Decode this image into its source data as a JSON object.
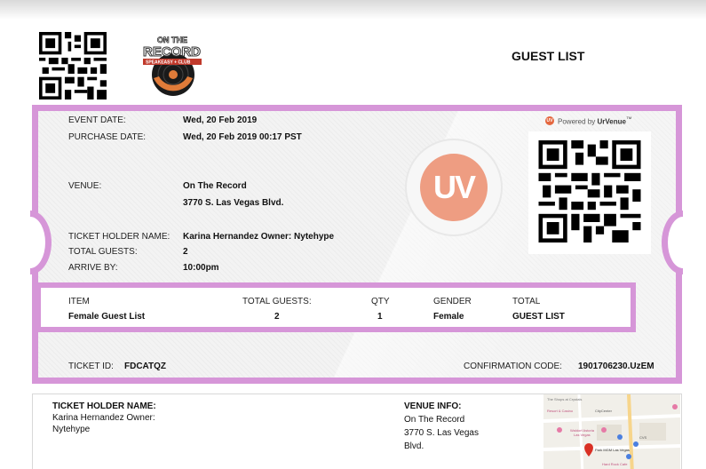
{
  "header": {
    "title": "GUEST LIST",
    "logo_text": [
      "ON THE",
      "RECORD",
      "SPEAKEASY + CLUB"
    ]
  },
  "powered_by": {
    "prefix": "Powered by",
    "brand": "UrVenue",
    "tm": "™",
    "badge": "UV"
  },
  "watermark": "UV",
  "ticket": {
    "event_date_label": "EVENT DATE:",
    "event_date": "Wed, 20 Feb 2019",
    "purchase_date_label": "PURCHASE DATE:",
    "purchase_date": "Wed, 20 Feb 2019 00:17 PST",
    "venue_label": "VENUE:",
    "venue_name": "On The Record",
    "venue_address": "3770 S. Las Vegas Blvd.",
    "holder_label": "TICKET HOLDER NAME:",
    "holder_name": "Karina Hernandez  Owner: Nytehype",
    "guests_label": "TOTAL GUESTS:",
    "guests": "2",
    "arrive_label": "ARRIVE BY:",
    "arrive": "10:00pm",
    "ticket_id_label": "TICKET ID:",
    "ticket_id": "FDCATQZ",
    "confirmation_label": "CONFIRMATION CODE:",
    "confirmation": "1901706230.UzEM"
  },
  "items": {
    "headers": [
      "ITEM",
      "TOTAL GUESTS:",
      "QTY",
      "GENDER",
      "TOTAL"
    ],
    "row": [
      "Female Guest List",
      "2",
      "1",
      "Female",
      "GUEST LIST"
    ]
  },
  "info": {
    "holder_heading": "TICKET HOLDER NAME:",
    "holder_lines": [
      "Karina Hernandez  Owner:",
      "Nytehype"
    ],
    "venue_heading": "VENUE INFO:",
    "venue_lines": [
      "On The Record",
      "3770 S. Las Vegas",
      "Blvd."
    ]
  },
  "map": {
    "labels": [
      "The Shops at Crystals",
      "Resort & Casino",
      "CityCenter",
      "Waldorf Astoria",
      "Las Vegas",
      "CVS",
      "Park MGM Las Vegas",
      "Hard Rock Cafe"
    ]
  },
  "colors": {
    "ticket_border": "#d696d8",
    "uv_orange": "#ee9d82",
    "brand_orange": "#e4673f"
  }
}
